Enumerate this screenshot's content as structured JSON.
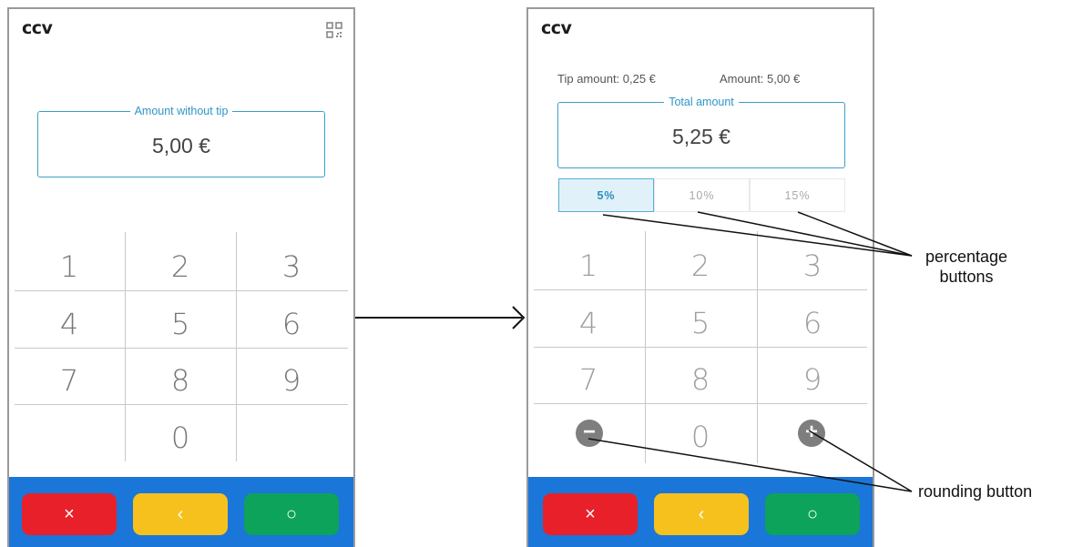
{
  "left_screen": {
    "logo": "ccv",
    "amount_field": {
      "label": "Amount without tip",
      "value": "5,00 €"
    },
    "keypad": [
      "1",
      "2",
      "3",
      "4",
      "5",
      "6",
      "7",
      "8",
      "9",
      "0"
    ],
    "actions": {
      "cancel": "×",
      "back": "‹",
      "confirm": "○"
    }
  },
  "right_screen": {
    "logo": "ccv",
    "tip_amount": "Tip amount: 0,25 €",
    "amount": "Amount: 5,00 €",
    "total_field": {
      "label": "Total amount",
      "value": "5,25 €"
    },
    "percentages": [
      "5%",
      "10%",
      "15%"
    ],
    "selected_percentage": "5%",
    "keypad": [
      "1",
      "2",
      "3",
      "4",
      "5",
      "6",
      "7",
      "8",
      "9",
      "0"
    ],
    "round_down": "−",
    "round_up": "+",
    "actions": {
      "cancel": "×",
      "back": "‹",
      "confirm": "○"
    }
  },
  "annotations": {
    "percentage_buttons": "percentage\nbuttons",
    "rounding_button": "rounding button"
  },
  "colors": {
    "accent": "#2f95c4",
    "bar": "#1a76d8",
    "cancel": "#e8202a",
    "back": "#f7c11d",
    "confirm": "#0ea35a"
  }
}
